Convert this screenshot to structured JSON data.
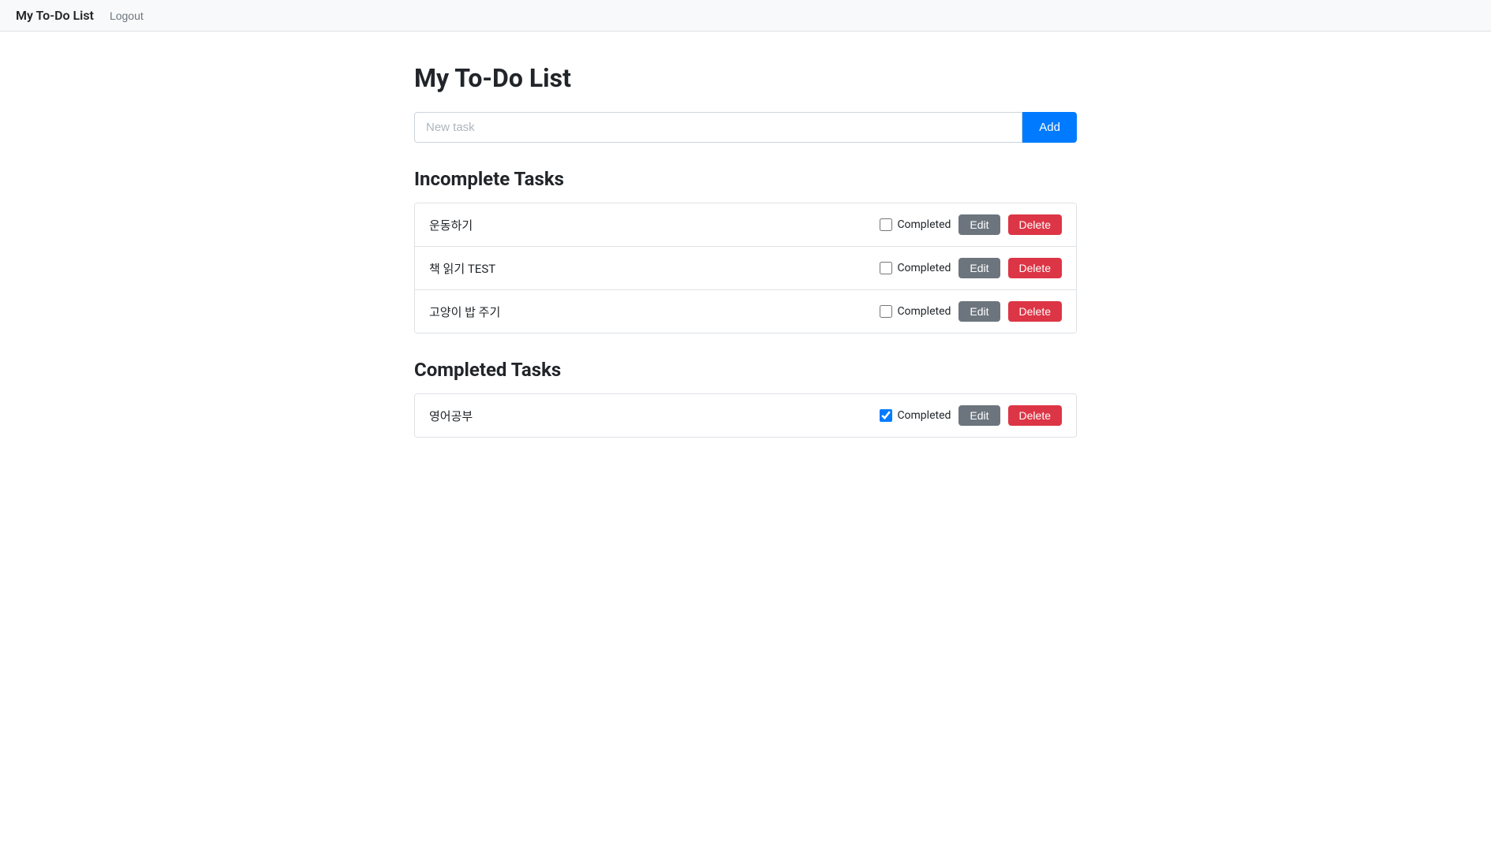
{
  "navbar": {
    "brand": "My To-Do List",
    "logout_label": "Logout"
  },
  "page": {
    "title": "My To-Do List"
  },
  "input": {
    "placeholder": "New task",
    "add_label": "Add"
  },
  "incomplete_section": {
    "title": "Incomplete Tasks",
    "tasks": [
      {
        "id": 1,
        "name": "운동하기",
        "completed": false
      },
      {
        "id": 2,
        "name": "책 읽기 TEST",
        "completed": false
      },
      {
        "id": 3,
        "name": "고양이 밥 주기",
        "completed": false
      }
    ]
  },
  "completed_section": {
    "title": "Completed Tasks",
    "tasks": [
      {
        "id": 4,
        "name": "영어공부",
        "completed": true
      }
    ]
  },
  "labels": {
    "completed": "Completed",
    "edit": "Edit",
    "delete": "Delete"
  }
}
